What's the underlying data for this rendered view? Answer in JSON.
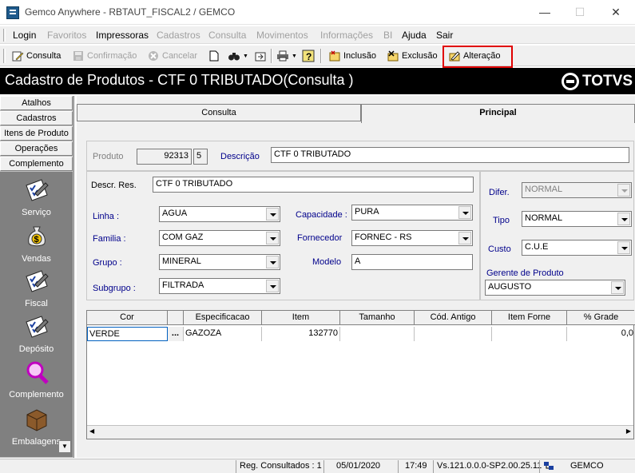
{
  "window": {
    "title": "Gemco Anywhere - RBTAUT_FISCAL2 / GEMCO",
    "min_glyph": "—",
    "max_glyph": "☐",
    "close_glyph": "✕"
  },
  "menu": [
    {
      "label": "Login",
      "enabled": true
    },
    {
      "label": "Favoritos",
      "enabled": false
    },
    {
      "label": "Impressoras",
      "enabled": true
    },
    {
      "label": "Cadastros",
      "enabled": false
    },
    {
      "label": "Consulta",
      "enabled": false
    },
    {
      "label": "Movimentos",
      "enabled": false
    },
    {
      "label": "Informações",
      "enabled": false
    },
    {
      "label": "BI",
      "enabled": false
    },
    {
      "label": "Ajuda",
      "enabled": true
    },
    {
      "label": "Sair",
      "enabled": true
    }
  ],
  "toolbar": {
    "consulta": "Consulta",
    "confirmacao": "Confirmação",
    "cancelar": "Cancelar",
    "inclusao": "Inclusão",
    "exclusao": "Exclusão",
    "alteracao": "Alteração"
  },
  "header": {
    "title": "Cadastro de Produtos  - CTF 0 TRIBUTADO(Consulta )",
    "brand": "TOTVS"
  },
  "sidebar": {
    "tabs": [
      "Atalhos",
      "Cadastros",
      "Itens de Produto",
      "Operações",
      "Complemento"
    ],
    "items": [
      {
        "label": "Serviço",
        "icon": "checklist-icon"
      },
      {
        "label": "Vendas",
        "icon": "money-bag-icon"
      },
      {
        "label": "Fiscal",
        "icon": "checklist-icon"
      },
      {
        "label": "Depósito",
        "icon": "checklist-icon"
      },
      {
        "label": "Complemento",
        "icon": "magnifier-icon"
      },
      {
        "label": "Embalagens",
        "icon": "box-icon"
      }
    ]
  },
  "tabs": {
    "consulta": "Consulta",
    "principal": "Principal"
  },
  "form": {
    "produto_label": "Produto",
    "produto_code": "92313",
    "produto_digit": "5",
    "descricao_label": "Descrição",
    "descricao": "CTF 0 TRIBUTADO",
    "descr_res_label": "Descr. Res.",
    "descr_res": "CTF 0 TRIBUTADO",
    "linha_label": "Linha :",
    "linha": "AGUA",
    "familia_label": "Familia :",
    "familia": "COM GAZ",
    "grupo_label": "Grupo :",
    "grupo": "MINERAL",
    "subgrupo_label": "Subgrupo :",
    "subgrupo": "FILTRADA",
    "capacidade_label": "Capacidade :",
    "capacidade": "PURA",
    "fornecedor_label": "Fornecedor",
    "fornecedor": "FORNEC - RS",
    "modelo_label": "Modelo",
    "modelo": "A",
    "difer_label": "Difer.",
    "difer": "NORMAL",
    "tipo_label": "Tipo",
    "tipo": "NORMAL",
    "custo_label": "Custo",
    "custo": "C.U.E",
    "gerente_label": "Gerente de Produto",
    "gerente": "AUGUSTO"
  },
  "grid": {
    "columns": [
      "Cor",
      "",
      "Especificacao",
      "Item",
      "Tamanho",
      "Cód. Antigo",
      "Item Forne",
      "% Grade"
    ],
    "rows": [
      [
        "VERDE",
        "...",
        "GAZOZA",
        "132770",
        "",
        "",
        "",
        "0,0"
      ]
    ]
  },
  "status": {
    "reg": "Reg. Consultados : 1",
    "date": "05/01/2020",
    "time": "17:49",
    "version": "Vs.121.0.0.0-SP2.00.25.11",
    "company": "GEMCO"
  }
}
